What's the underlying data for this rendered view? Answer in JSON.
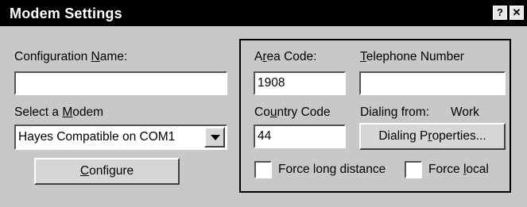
{
  "window": {
    "title": "Modem Settings",
    "help_glyph": "?",
    "close_glyph": "✕"
  },
  "left": {
    "config_name_label": {
      "pre": "Configuration ",
      "key": "N",
      "post": "ame:"
    },
    "config_name_value": "",
    "select_modem_label": {
      "pre": "Select a ",
      "key": "M",
      "post": "odem"
    },
    "modem_selected": "Hayes Compatible on COM1",
    "configure_button": {
      "pre": "",
      "key": "C",
      "post": "onfigure"
    }
  },
  "right": {
    "area_code_label": {
      "pre": "A",
      "key": "r",
      "post": "ea Code:"
    },
    "area_code_value": "1908",
    "telephone_label": {
      "pre": "",
      "key": "T",
      "post": "elephone Number"
    },
    "telephone_value": "",
    "country_code_label": {
      "pre": "Co",
      "key": "u",
      "post": "ntry Code"
    },
    "country_code_value": "44",
    "dialing_from_label": "Dialing from:",
    "dialing_from_value": "Work",
    "dialing_properties_button": {
      "pre": "Dialing P",
      "key": "r",
      "post": "operties..."
    },
    "force_long_distance": {
      "pre": "Force lon",
      "key": "g",
      "post": " distance",
      "checked": false
    },
    "force_local": {
      "pre": "Force ",
      "key": "l",
      "post": "ocal",
      "checked": false
    }
  }
}
